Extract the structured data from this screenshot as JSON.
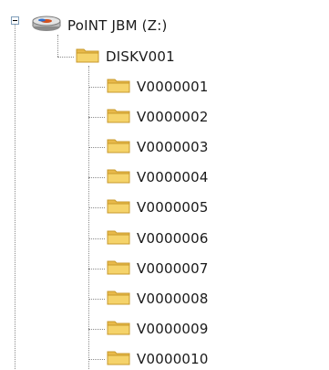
{
  "drive": {
    "label": "PoINT JBM (Z:)",
    "icon": "network-drive-icon",
    "expanded": true
  },
  "disk": {
    "label": "DISKV001",
    "icon": "folder-icon"
  },
  "volumes": [
    {
      "label": "V0000001"
    },
    {
      "label": "V0000002"
    },
    {
      "label": "V0000003"
    },
    {
      "label": "V0000004"
    },
    {
      "label": "V0000005"
    },
    {
      "label": "V0000006"
    },
    {
      "label": "V0000007"
    },
    {
      "label": "V0000008"
    },
    {
      "label": "V0000009"
    },
    {
      "label": "V0000010"
    }
  ],
  "colors": {
    "folder_body": "#f5d36a",
    "folder_edge": "#c89a2c",
    "tree_lines": "#8c8c8c"
  }
}
